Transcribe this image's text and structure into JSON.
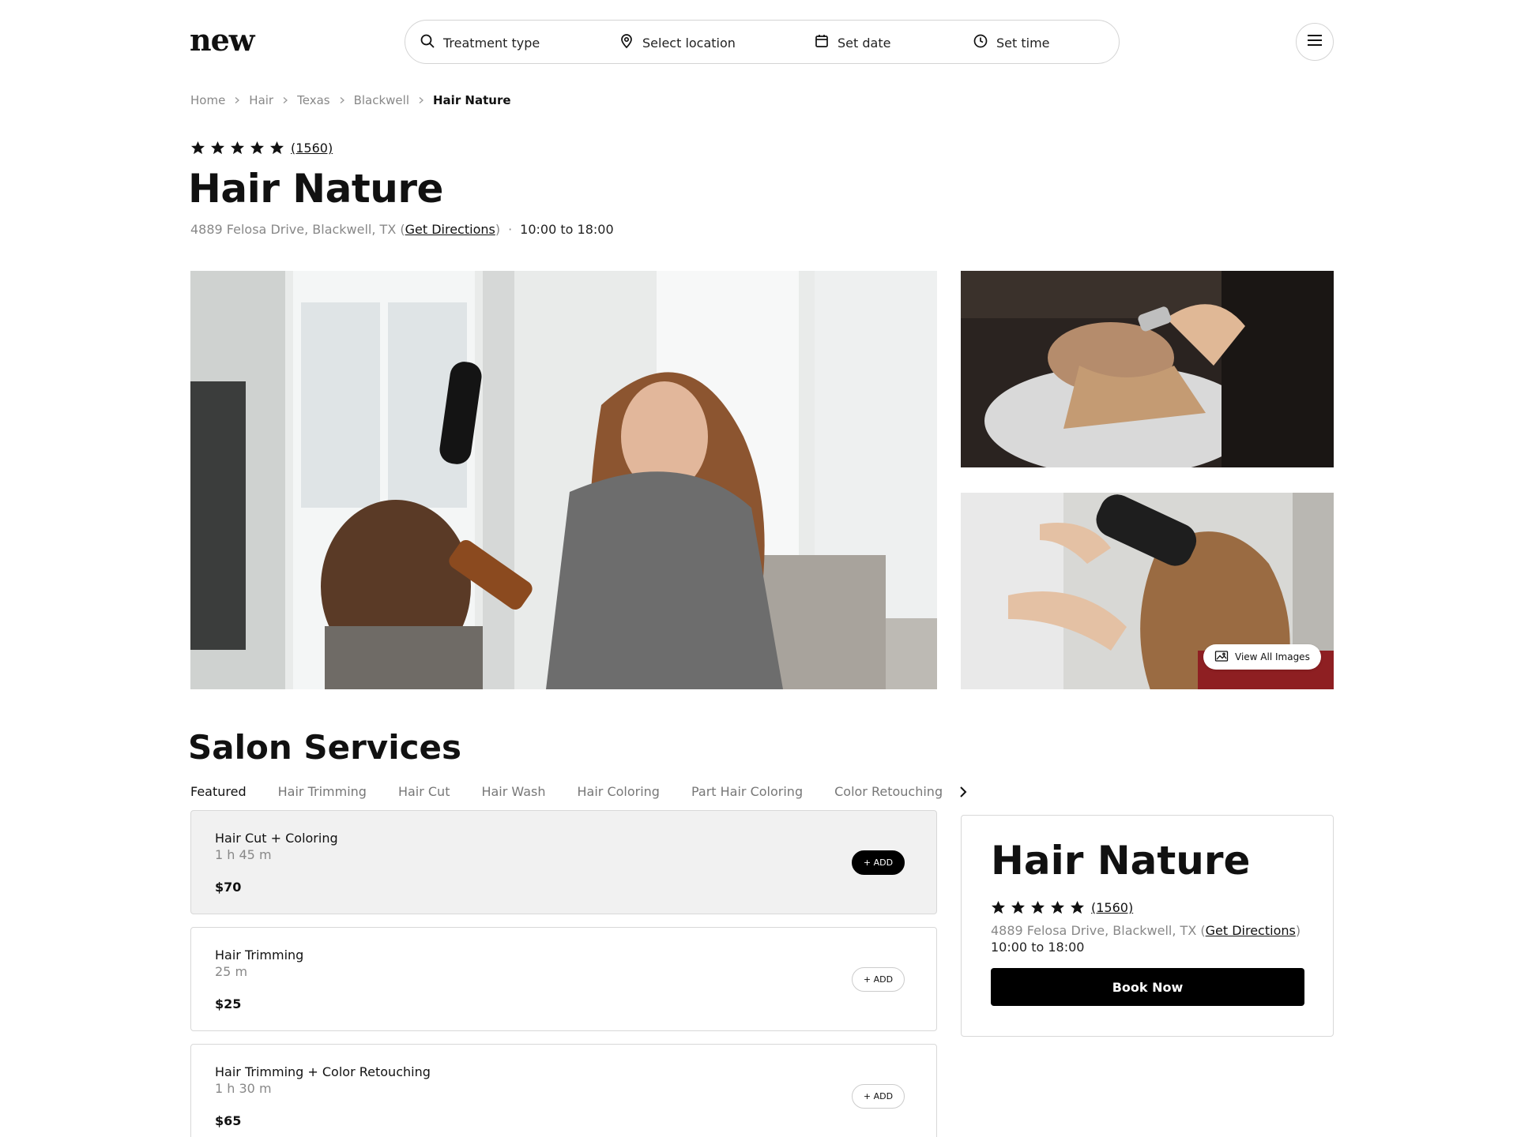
{
  "header": {
    "logo": "new",
    "search": {
      "treatment": "Treatment type",
      "location": "Select location",
      "date": "Set date",
      "time": "Set time"
    }
  },
  "breadcrumb": {
    "items": [
      "Home",
      "Hair",
      "Texas",
      "Blackwell"
    ],
    "current": "Hair Nature"
  },
  "salon": {
    "name": "Hair Nature",
    "rating_stars": 5,
    "review_count": "(1560)",
    "address": "4889 Felosa Drive, Blackwell, TX",
    "directions_label": "Get Directions",
    "hours": "10:00 to 18:00"
  },
  "gallery": {
    "view_all_label": "View All Images"
  },
  "services": {
    "title": "Salon Services",
    "tabs": [
      "Featured",
      "Hair Trimming",
      "Hair Cut",
      "Hair Wash",
      "Hair Coloring",
      "Part Hair Coloring",
      "Color Retouching"
    ],
    "items": [
      {
        "name": "Hair Cut + Coloring",
        "duration": "1 h 45 m",
        "price": "$70",
        "add_label": "+ ADD"
      },
      {
        "name": "Hair Trimming",
        "duration": "25 m",
        "price": "$25",
        "add_label": "+ ADD"
      },
      {
        "name": "Hair Trimming + Color Retouching",
        "duration": "1 h 30 m",
        "price": "$65",
        "add_label": "+ ADD"
      }
    ]
  },
  "booking": {
    "book_label": "Book Now"
  },
  "colors": {
    "primary": "#000000",
    "muted_text": "#888888",
    "border": "#d8d8d8",
    "selected_card": "#f1f1f1"
  }
}
